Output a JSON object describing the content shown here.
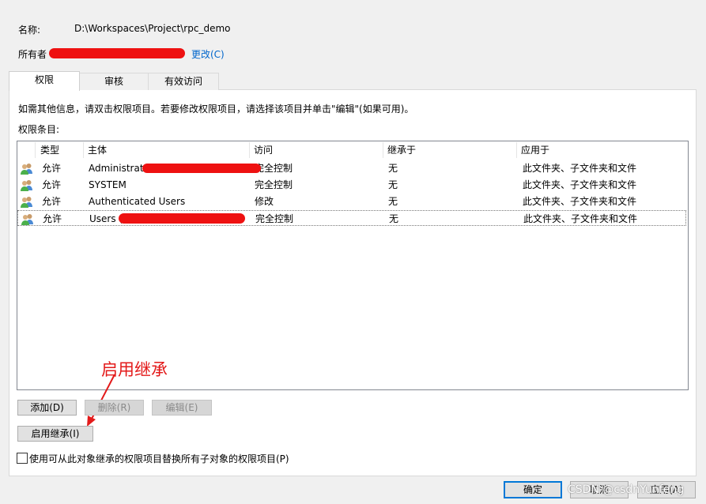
{
  "header": {
    "name_label": "名称:",
    "name_value": "D:\\Workspaces\\Project\\rpc_demo",
    "owner_label": "所有者",
    "owner_change_link": "更改(C)"
  },
  "tabs": [
    {
      "label": "权限"
    },
    {
      "label": "审核"
    },
    {
      "label": "有效访问"
    }
  ],
  "info_text": "如需其他信息，请双击权限项目。若要修改权限项目，请选择该项目并单击\"编辑\"(如果可用)。",
  "entries_label": "权限条目:",
  "columns": [
    "类型",
    "主体",
    "访问",
    "继承于",
    "应用于"
  ],
  "rows": [
    {
      "type": "允许",
      "principal": "Administrators (",
      "access": "完全控制",
      "inherited": "无",
      "applies": "此文件夹、子文件夹和文件"
    },
    {
      "type": "允许",
      "principal": "SYSTEM",
      "access": "完全控制",
      "inherited": "无",
      "applies": "此文件夹、子文件夹和文件"
    },
    {
      "type": "允许",
      "principal": "Authenticated Users",
      "access": "修改",
      "inherited": "无",
      "applies": "此文件夹、子文件夹和文件"
    },
    {
      "type": "允许",
      "principal": "Users (",
      "access": "完全控制",
      "inherited": "无",
      "applies": "此文件夹、子文件夹和文件"
    }
  ],
  "buttons": {
    "add": "添加(D)",
    "remove": "删除(R)",
    "edit": "编辑(E)",
    "enable_inheritance": "启用继承(I)"
  },
  "replace_checkbox_label": "使用可从此对象继承的权限项目替换所有子对象的权限项目(P)",
  "footer": {
    "ok": "确定",
    "cancel": "取消",
    "apply": "应用(A)"
  },
  "annotation": "启用继承",
  "watermark": "CSDN @csdnYunfeng",
  "colors": {
    "annotation": "#e31a1a",
    "link": "#0066cc",
    "accent_border": "#0078d7"
  }
}
